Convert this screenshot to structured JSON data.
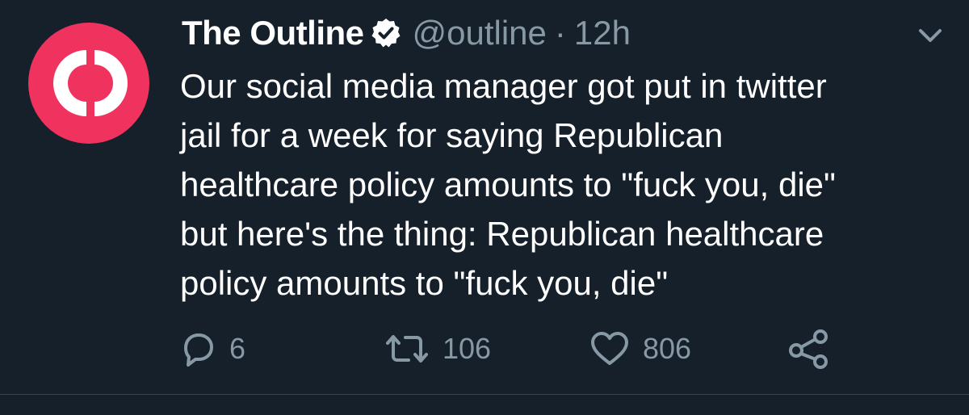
{
  "tweet": {
    "display_name": "The Outline",
    "handle": "@outline",
    "separator": "·",
    "time": "12h",
    "text": "Our social media manager got put in twitter\njail for a week for saying Republican\nhealthcare policy amounts to \"fuck you, die\"\nbut here's the thing: Republican healthcare\npolicy amounts to \"fuck you, die\"",
    "stats": {
      "replies": "6",
      "retweets": "106",
      "likes": "806"
    }
  },
  "colors": {
    "background": "#15202b",
    "text_primary": "#ffffff",
    "text_secondary": "#8899a6",
    "avatar_brand": "#f0325e",
    "divider": "#38444d"
  },
  "icons": {
    "avatar": "outline-logo",
    "verified": "verified-badge-icon",
    "menu": "chevron-down-icon",
    "reply": "reply-icon",
    "retweet": "retweet-icon",
    "like": "heart-icon",
    "share": "share-icon"
  }
}
